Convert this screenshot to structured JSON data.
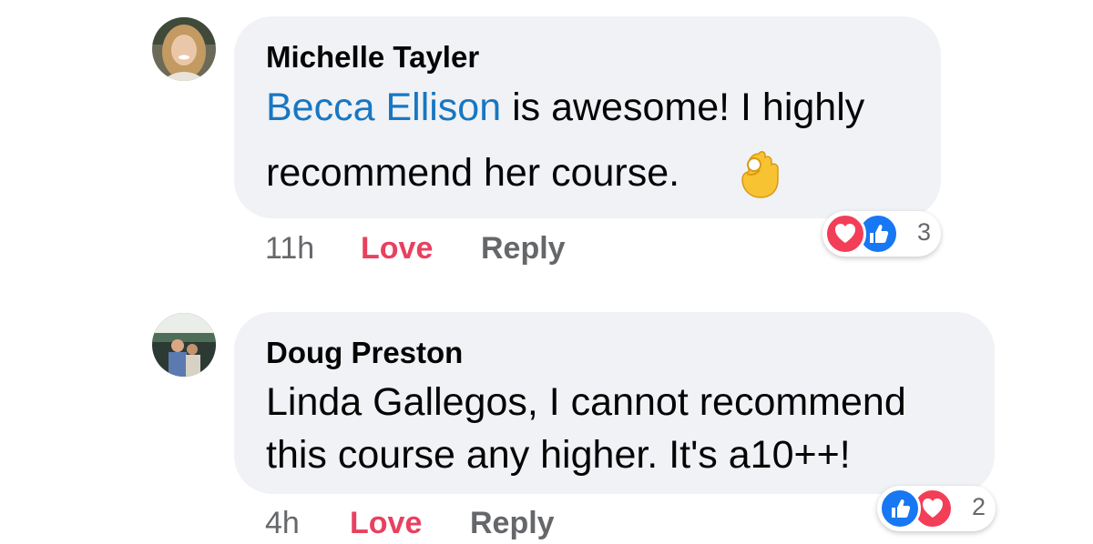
{
  "comments": [
    {
      "author": "Michelle Tayler",
      "mention": "Becca Ellison",
      "text_line1_rest": " is awesome! I highly",
      "text_line2": "recommend her course.",
      "emoji_icon": "ok-hand-emoji-icon",
      "time": "11h",
      "love_label": "Love",
      "reply_label": "Reply",
      "reaction_count": "3",
      "reactions": [
        "love",
        "like"
      ]
    },
    {
      "author": "Doug Preston",
      "text_line1": "Linda Gallegos, I cannot recommend",
      "text_line2": "this course any higher. It's a10++!",
      "time": "4h",
      "love_label": "Love",
      "reply_label": "Reply",
      "reaction_count": "2",
      "reactions": [
        "like",
        "love"
      ]
    }
  ],
  "colors": {
    "bubble": "#f0f2f5",
    "mention": "#1877c2",
    "love": "#e8415f",
    "like_blue": "#1877f2",
    "meta_gray": "#65676b"
  }
}
